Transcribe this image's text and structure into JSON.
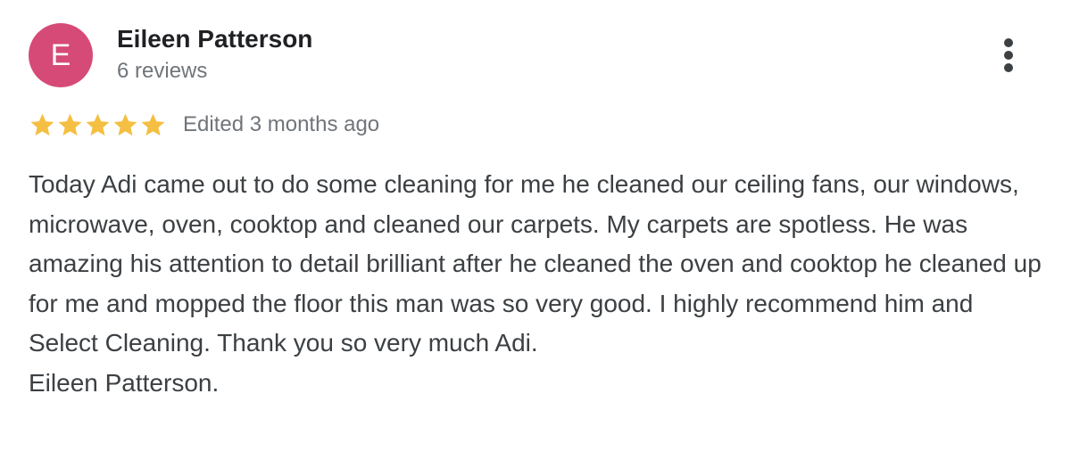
{
  "reviewer": {
    "avatar_letter": "E",
    "avatar_color": "#d64a78",
    "name": "Eileen Patterson",
    "review_count": "6 reviews"
  },
  "menu": {
    "icon": "more-vert-icon"
  },
  "review": {
    "rating": 5,
    "rating_max": 5,
    "star_color": "#f4bf42",
    "date": "Edited 3 months ago",
    "text": "Today Adi came out to do some cleaning for me he cleaned our ceiling fans, our windows, microwave, oven, cooktop and cleaned our carpets. My carpets are spotless. He was amazing his attention to detail brilliant after he cleaned the oven and cooktop he cleaned up for me and mopped the floor this man was so very good. I highly recommend him and Select Cleaning. Thank you so very much Adi.\nEileen Patterson."
  }
}
